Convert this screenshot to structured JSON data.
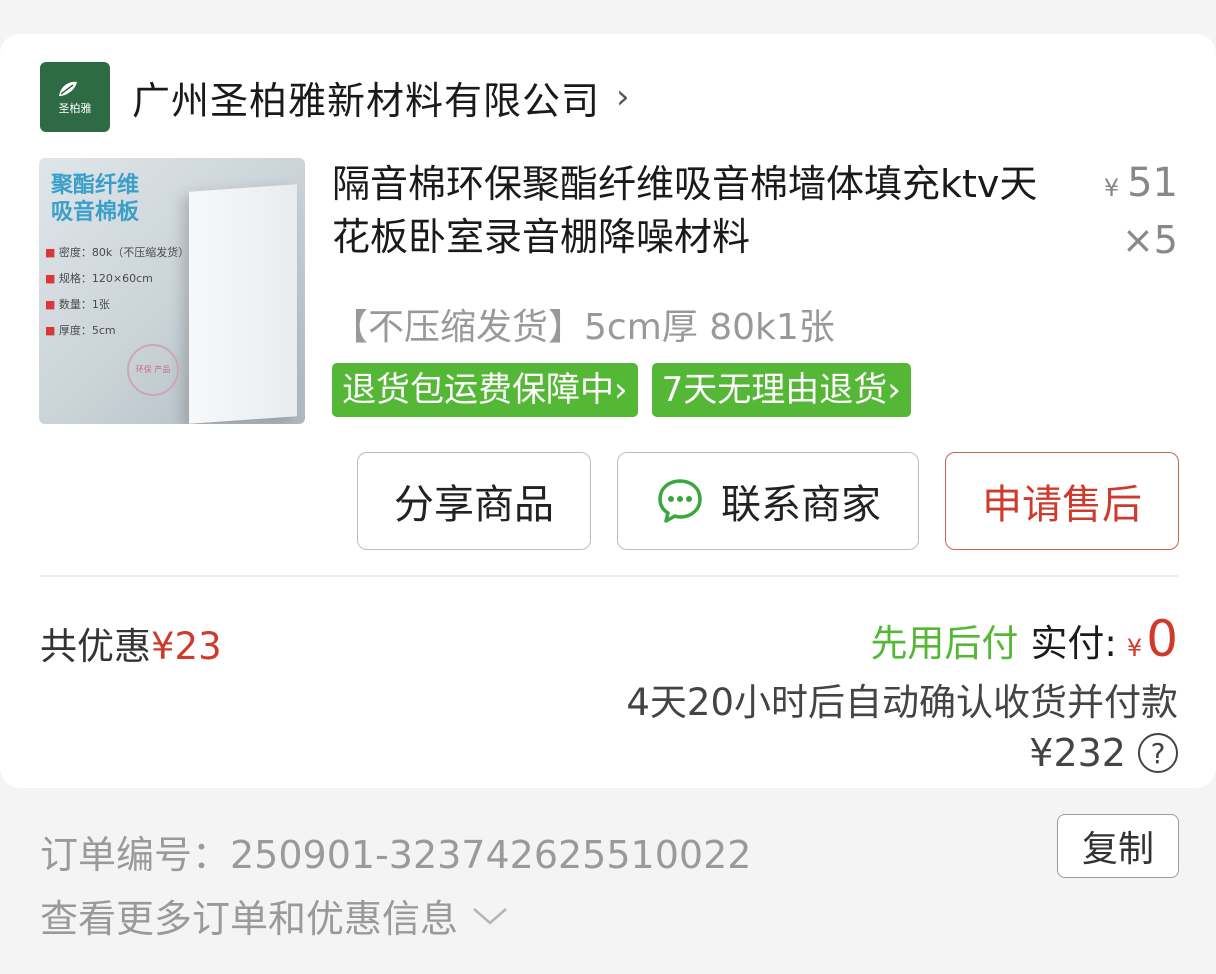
{
  "shop": {
    "logo_text": "圣柏雅",
    "name": "广州圣柏雅新材料有限公司",
    "chevron": "›"
  },
  "product": {
    "image": {
      "title_line1": "聚酯纤维",
      "title_line2": "吸音棉板",
      "specs": [
        "密度：80k（不压缩发货）",
        "规格：120×60cm",
        "数量：1张",
        "厚度：5cm"
      ],
      "seal_text": "环保 产品"
    },
    "title": "隔音棉环保聚酯纤维吸音棉墙体填充ktv天花板卧室录音棚降噪材料",
    "price_symbol": "¥",
    "price": "51",
    "quantity": "×5",
    "spec": "【不压缩发货】5cm厚 80k1张",
    "tags": [
      "退货包运费保障中›",
      "7天无理由退货›"
    ]
  },
  "actions": {
    "share": "分享商品",
    "contact": "联系商家",
    "after_sale": "申请售后"
  },
  "summary": {
    "discount_label": "共优惠",
    "discount_amount": "¥23",
    "pay_later": "先用后付",
    "paid_label": "实付:",
    "paid_symbol": "¥",
    "paid_amount": "0",
    "auto_confirm": "4天20小时后自动确认收货并付款",
    "total": "¥232",
    "help_symbol": "?"
  },
  "order": {
    "number_label": "订单编号：250901-323742625510022",
    "copy_label": "复制",
    "more_info": "查看更多订单和优惠信息"
  },
  "colors": {
    "green": "#55b736",
    "red": "#cf3a2c",
    "logo_bg": "#2e6b45"
  },
  "icons": {
    "contact": "chat-bubble-icon",
    "help": "question-circle-icon",
    "more": "chevron-down-icon"
  }
}
